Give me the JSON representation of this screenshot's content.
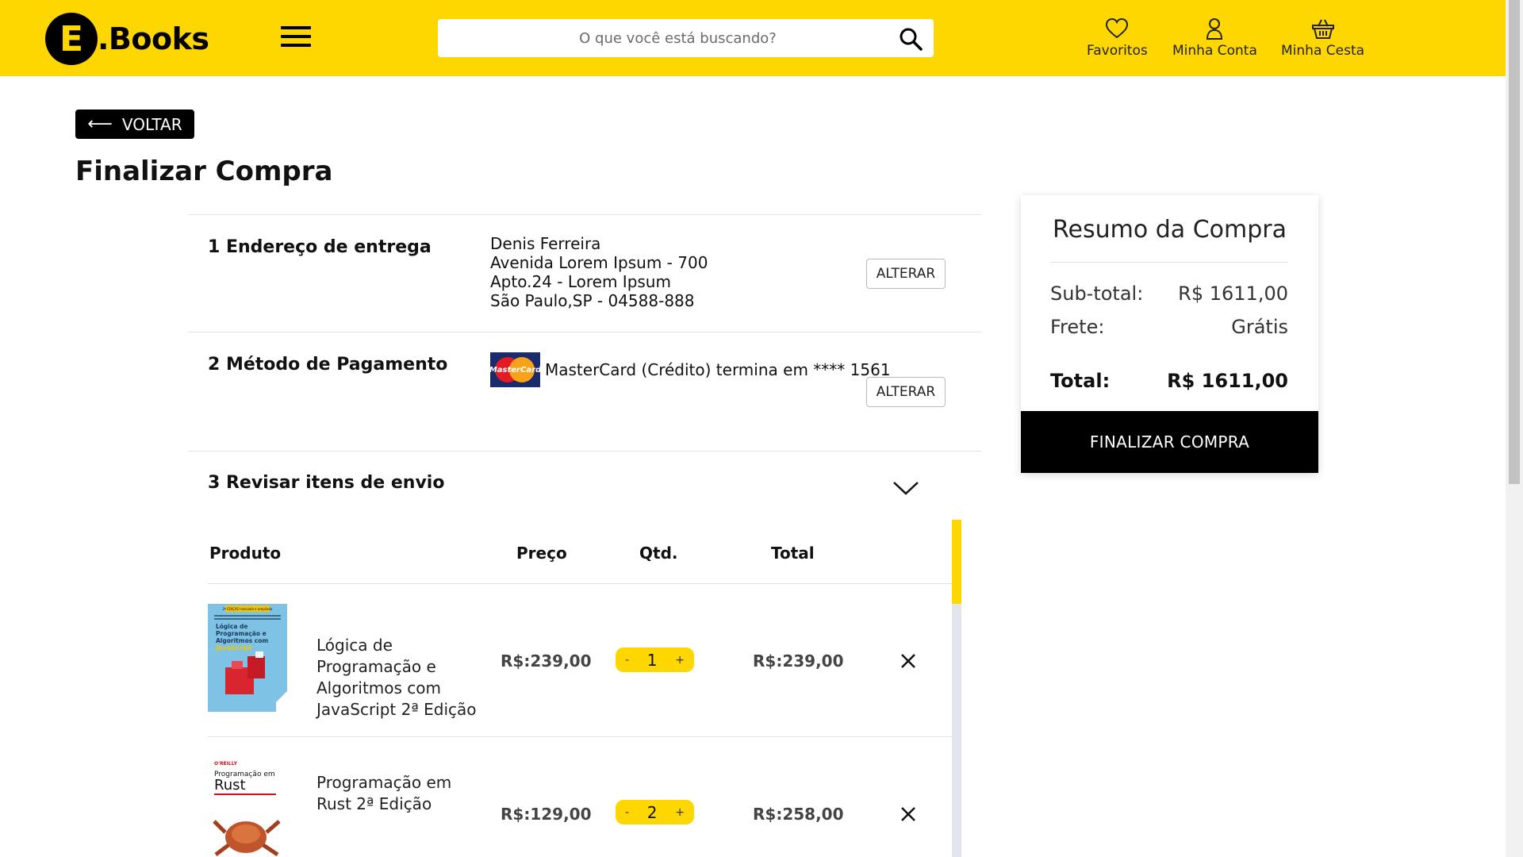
{
  "header": {
    "logo_letter": "E",
    "logo_text": ".Books",
    "search_placeholder": "O que você está buscando?",
    "favorites_label": "Favoritos",
    "account_label": "Minha Conta",
    "cart_label": "Minha Cesta",
    "brand_color": "#ffd700"
  },
  "back_label": "VOLTAR",
  "page_title": "Finalizar Compra",
  "sections": {
    "address": {
      "title": "1 Endereço de entrega",
      "lines": [
        "Denis Ferreira",
        "Avenida Lorem Ipsum - 700",
        "Apto.24 - Lorem Ipsum",
        "São Paulo,SP - 04588-888"
      ],
      "button": "ALTERAR"
    },
    "payment": {
      "title": "2 Método de Pagamento",
      "card_brand": "MasterCard",
      "description": "MasterCard (Crédito) termina em **** 1561",
      "button": "ALTERAR"
    },
    "review": {
      "title": "3 Revisar itens de envio"
    }
  },
  "table": {
    "headers": {
      "product": "Produto",
      "price": "Preço",
      "qty": "Qtd.",
      "total": "Total"
    },
    "items": [
      {
        "name": "Lógica de Programação e Algoritmos com JavaScript 2ª Edição",
        "price": "R$:239,00",
        "qty": "1",
        "total": "R$:239,00",
        "minus": "-",
        "plus": "+"
      },
      {
        "name": "Programação em Rust 2ª Edição",
        "price": "R$:129,00",
        "qty": "2",
        "total": "R$:258,00",
        "minus": "-",
        "plus": "+"
      }
    ]
  },
  "summary": {
    "title": "Resumo da Compra",
    "subtotal_label": "Sub-total:",
    "subtotal_value": "R$ 1611,00",
    "shipping_label": "Frete:",
    "shipping_value": "Grátis",
    "total_label": "Total:",
    "total_value": "R$ 1611,00",
    "button": "FINALIZAR COMPRA"
  },
  "book_covers": {
    "book1": {
      "edition_tag": "2ª EDIÇÃO revisada e ampliada",
      "title": "Lógica de Programação e Algoritmos com",
      "subtitle": "JavaScript"
    },
    "book2": {
      "publisher": "O'REILLY",
      "title_line1": "Programação em",
      "title_line2": "Rust"
    }
  }
}
